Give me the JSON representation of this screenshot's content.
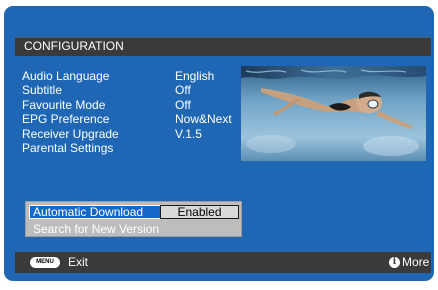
{
  "header": {
    "title": "CONFIGURATION"
  },
  "settings": [
    {
      "label": "Audio Language",
      "value": "English"
    },
    {
      "label": "Subtitle",
      "value": "Off"
    },
    {
      "label": "Favourite Mode",
      "value": "Off"
    },
    {
      "label": "EPG Preference",
      "value": "Now&Next"
    },
    {
      "label": "Receiver Upgrade",
      "value": "V.1.5"
    },
    {
      "label": "Parental Settings",
      "value": ""
    }
  ],
  "upgrade_panel": {
    "automatic_download_label": "Automatic Download",
    "automatic_download_value": "Enabled",
    "search_label": "Search for New Version"
  },
  "footer": {
    "menu_key": "MENU",
    "exit_label": "Exit",
    "info_icon": "i",
    "more_label": "More"
  },
  "preview": {
    "icon": "swimmer-underwater-image"
  },
  "colors": {
    "frame": "#1f67b5",
    "bars": "#3a3a3a",
    "selection": "#1568c8",
    "panel": "#bdbdbd"
  }
}
